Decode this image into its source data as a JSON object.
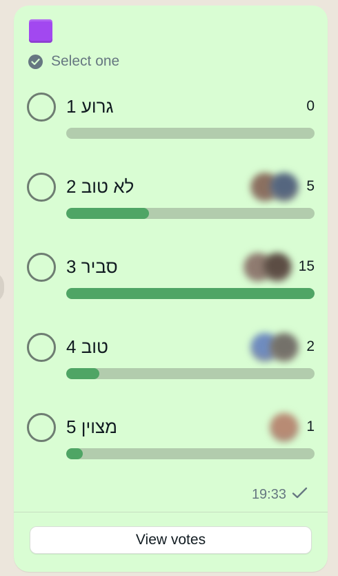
{
  "poll": {
    "title_icon": "purple-square-emoji",
    "select_text": "Select one",
    "time": "19:33",
    "status_icon": "check-icon",
    "view_votes_label": "View votes",
    "options": [
      {
        "label": "גרוע 1",
        "count": "0",
        "fraction": 0,
        "avatar_colors": []
      },
      {
        "label": "לא טוב 2",
        "count": "5",
        "fraction": 0.333,
        "avatar_colors": [
          "#8b7060",
          "#55667f"
        ]
      },
      {
        "label": "סביר 3",
        "count": "15",
        "fraction": 1,
        "avatar_colors": [
          "#8f7b70",
          "#5c4d44"
        ]
      },
      {
        "label": "טוב 4",
        "count": "2",
        "fraction": 0.133,
        "avatar_colors": [
          "#6f8cbf",
          "#74716a"
        ]
      },
      {
        "label": "מצוין 5",
        "count": "1",
        "fraction": 0.067,
        "avatar_colors": [
          "#b88b74"
        ]
      }
    ]
  },
  "colors": {
    "bubble": "#d9fdd3",
    "track": "#b2ccad",
    "fill": "#4fa565",
    "title_emoji": "#a248f0"
  }
}
